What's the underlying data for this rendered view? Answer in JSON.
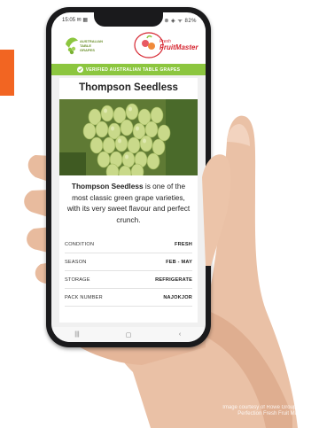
{
  "status_bar": {
    "time": "15:05 ✉ ▦",
    "icons": "⊗ ◈ ᯤ 82%"
  },
  "header": {
    "left_logo_text": [
      "AUSTRALIAN",
      "TABLE",
      "GRAPES"
    ],
    "right_logo_text": "FruitMaster",
    "right_logo_fresh": "Fresh"
  },
  "verified_banner": {
    "label": "VERIFIED AUSTRALIAN TABLE GRAPES",
    "icon": "check-circle-icon"
  },
  "product": {
    "title": "Thompson Seedless",
    "description_bold": "Thompson Seedless",
    "description_rest": " is one of the most classic green grape varieties, with its very sweet flavour and perfect crunch."
  },
  "info_rows": [
    {
      "label": "CONDITION",
      "value": "FRESH"
    },
    {
      "label": "SEASON",
      "value": "FEB - MAY"
    },
    {
      "label": "STORAGE",
      "value": "REFRIGERATE"
    },
    {
      "label": "PACK NUMBER",
      "value": "NAJOKJOR"
    }
  ],
  "nav": {
    "recent": "|||",
    "home": "▢",
    "back": "‹"
  },
  "credit": {
    "line1": "Image courtesy of Rowe Group and",
    "line2": "Perfection Fresh Fruit Master"
  },
  "colors": {
    "accent_green": "#8cc63f",
    "orange": "#f26522",
    "logo_red": "#d62631"
  }
}
